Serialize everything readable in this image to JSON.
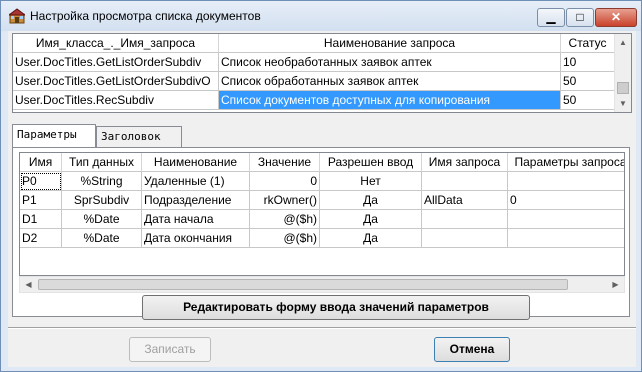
{
  "window": {
    "title": "Настройка просмотра списка документов",
    "controls": {
      "minimize": "▁",
      "maximize": "□",
      "close": "✕"
    }
  },
  "queries": {
    "headers": [
      "Имя_класса_._Имя_запроса",
      "Наименование запроса",
      "Статус"
    ],
    "rows": [
      [
        "User.DocTitles.GetListOrderSubdiv",
        "Список необработанных заявок аптек",
        "10"
      ],
      [
        "User.DocTitles.GetListOrderSubdivO",
        "Список обработанных заявок аптек",
        "50"
      ],
      [
        "User.DocTitles.RecSubdiv",
        "Список документов доступных для копирования",
        "50"
      ]
    ],
    "selected_row": 2
  },
  "tabs": [
    {
      "label": "Параметры",
      "active": true
    },
    {
      "label": "Заголовок",
      "active": false
    }
  ],
  "params": {
    "headers": [
      "Имя",
      "Тип данных",
      "Наименование",
      "Значение",
      "Разрешен ввод",
      "Имя запроса",
      "Параметры запроса"
    ],
    "rows": [
      [
        "P0",
        "%String",
        "Удаленные (1)",
        "0",
        "Нет",
        "",
        ""
      ],
      [
        "P1",
        "SprSubdiv",
        "Подразделение",
        "rkOwner()",
        "Да",
        "AllData",
        "0"
      ],
      [
        "D1",
        "%Date",
        "Дата начала",
        "@($h)",
        "Да",
        "",
        ""
      ],
      [
        "D2",
        "%Date",
        "Дата окончания",
        "@($h)",
        "Да",
        "",
        ""
      ]
    ]
  },
  "buttons": {
    "edit_form": "Редактировать форму ввода значений параметров",
    "save": "Записать",
    "cancel": "Отмена"
  },
  "colors": {
    "selection": "#3399ff",
    "title_bar": "#d3e0f0"
  }
}
